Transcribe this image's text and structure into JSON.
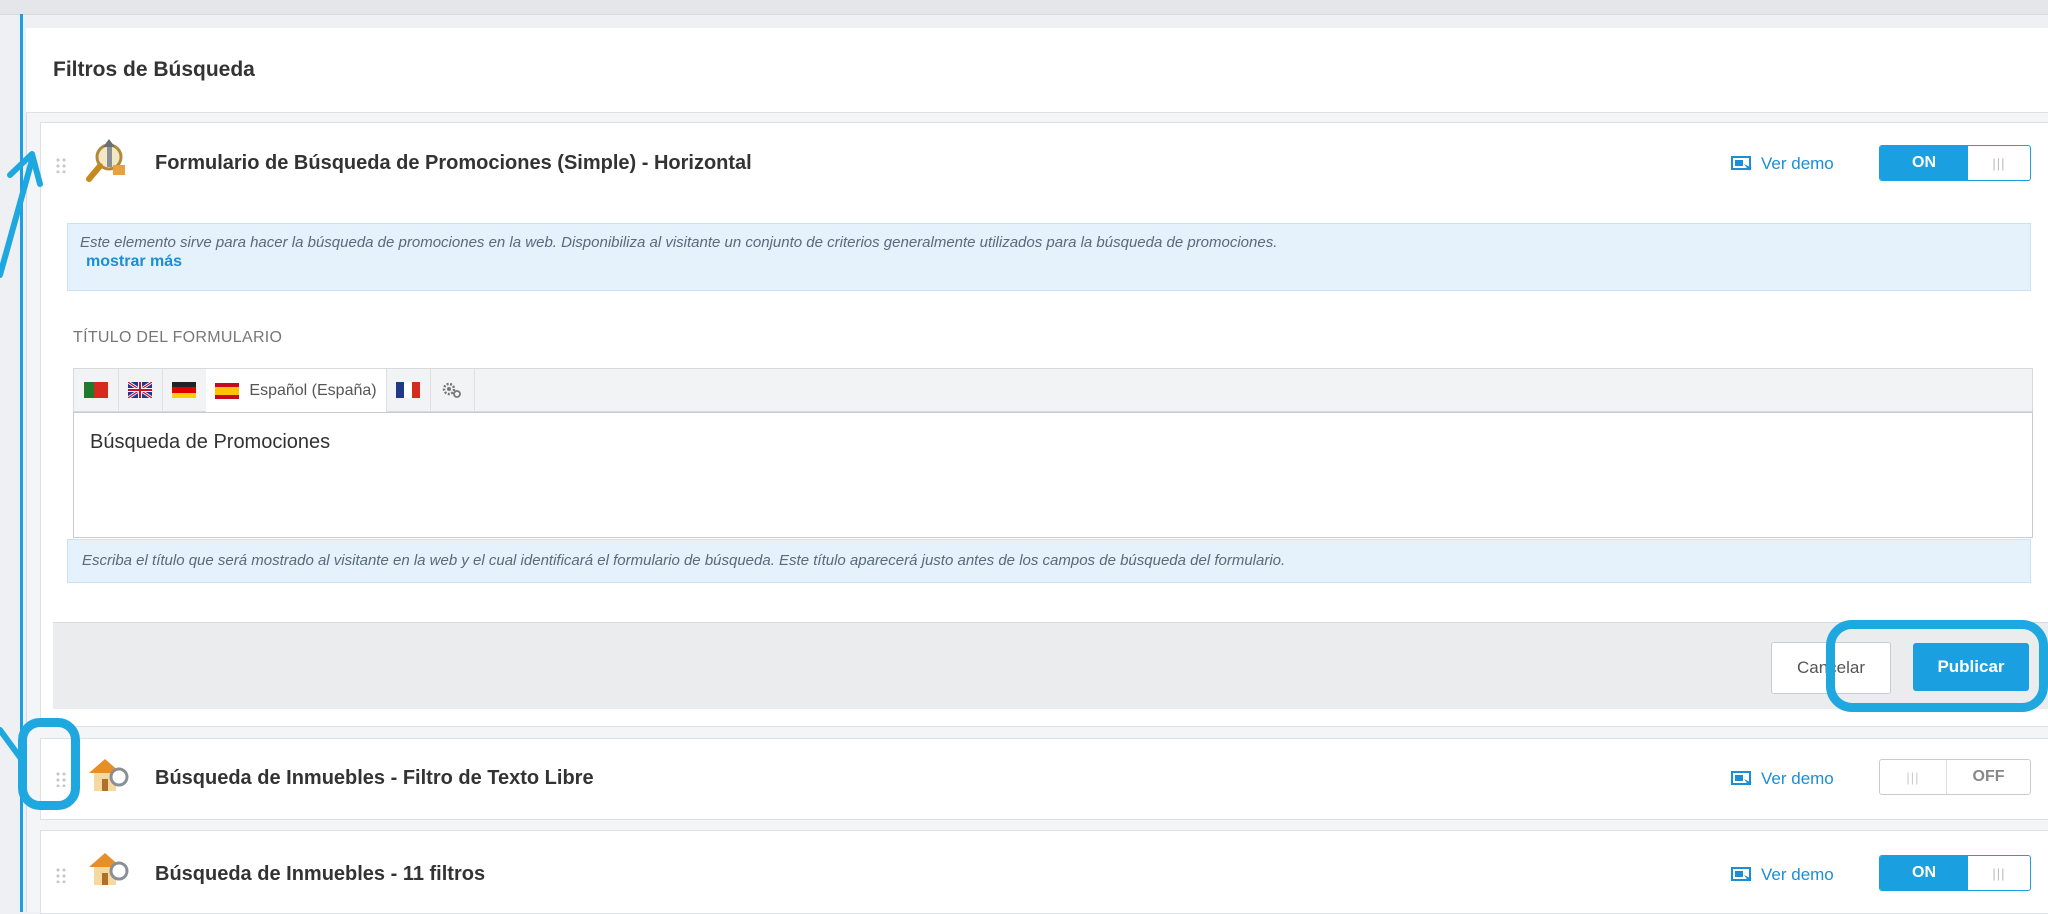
{
  "section": {
    "title": "Filtros de Búsqueda"
  },
  "items": [
    {
      "title": "Formulario de Búsqueda de Promociones (Simple) - Horizontal",
      "demo_label": "Ver demo",
      "toggle": {
        "state": "on",
        "label": "ON",
        "knob": "|||"
      },
      "expanded": {
        "description": "Este elemento sirve para hacer la búsqueda de promociones en la web. Disponibiliza al visitante un conjunto de criterios generalmente utilizados para la búsqueda de promociones.",
        "show_more": "mostrar más",
        "field_label": "TÍTULO DEL FORMULARIO",
        "language_tabs": [
          {
            "flag": "portugal-flag"
          },
          {
            "flag": "uk-flag"
          },
          {
            "flag": "germany-flag"
          },
          {
            "flag": "spain-flag",
            "label": "Español (España)",
            "active": true
          },
          {
            "flag": "france-flag"
          },
          {
            "icon": "settings-gears-icon"
          }
        ],
        "field_value": "Búsqueda de Promociones",
        "help_text": "Escriba el título que será mostrado al visitante en la web y el cual identificará el formulario de búsqueda. Este título aparecerá justo antes de los campos de búsqueda del formulario.",
        "cancel_label": "Cancelar",
        "publish_label": "Publicar"
      }
    },
    {
      "title": "Búsqueda de Inmuebles - Filtro de Texto Libre",
      "demo_label": "Ver demo",
      "toggle": {
        "state": "off",
        "label": "OFF",
        "knob": "|||"
      }
    },
    {
      "title": "Búsqueda de Inmuebles - 11 filtros",
      "demo_label": "Ver demo",
      "toggle": {
        "state": "on",
        "label": "ON",
        "knob": "|||"
      }
    }
  ],
  "colors": {
    "accent": "#1a9fe0",
    "annotation": "#1fa8e0",
    "info_bg": "#e5f1fb"
  }
}
